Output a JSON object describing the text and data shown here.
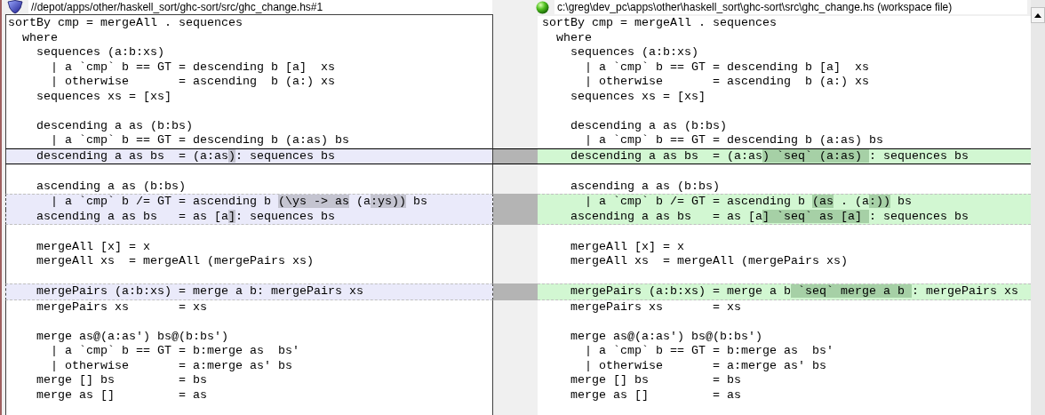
{
  "left_file": {
    "path": "//depot/apps/other/haskell_sort/ghc-sort/src/ghc_change.hs#1"
  },
  "right_file": {
    "path": "c:\\greg\\dev_pc\\apps\\other\\haskell_sort\\ghc-sort\\src\\ghc_change.hs (workspace file)"
  },
  "rows": [
    {
      "kind": "code",
      "left": "sortBy cmp = mergeAll . sequences",
      "right": "sortBy cmp = mergeAll . sequences"
    },
    {
      "kind": "code",
      "left": "  where",
      "right": "  where"
    },
    {
      "kind": "code",
      "left": "    sequences (a:b:xs)",
      "right": "    sequences (a:b:xs)"
    },
    {
      "kind": "code",
      "left": "      | a `cmp` b == GT = descending b [a]  xs",
      "right": "      | a `cmp` b == GT = descending b [a]  xs"
    },
    {
      "kind": "code",
      "left": "      | otherwise       = ascending  b (a:) xs",
      "right": "      | otherwise       = ascending  b (a:) xs"
    },
    {
      "kind": "code",
      "left": "    sequences xs = [xs]",
      "right": "    sequences xs = [xs]"
    },
    {
      "kind": "blank"
    },
    {
      "kind": "code",
      "left": "    descending a as (b:bs)",
      "right": "    descending a as (b:bs)"
    },
    {
      "kind": "code",
      "left": "      | a `cmp` b == GT = descending b (a:as) bs",
      "right": "      | a `cmp` b == GT = descending b (a:as) bs"
    },
    {
      "kind": "change",
      "current": true,
      "left": [
        {
          "text": "    descending a as bs  = (a:as",
          "changed": false
        },
        {
          "text": ")",
          "changed": true
        },
        {
          "text": ": sequences bs",
          "changed": false
        }
      ],
      "right": [
        {
          "text": "    descending a as bs  = (a:as",
          "changed": false
        },
        {
          "text": ") `seq` (a:as) ",
          "changed": true
        },
        {
          "text": ": sequences bs",
          "changed": false
        }
      ]
    },
    {
      "kind": "blank"
    },
    {
      "kind": "code",
      "left": "    ascending a as (b:bs)",
      "right": "    ascending a as (b:bs)"
    },
    {
      "kind": "change",
      "current": false,
      "left": [
        {
          "text": "      | a `cmp` b /= GT = ascending b ",
          "changed": false
        },
        {
          "text": "(\\ys -> as",
          "changed": true
        },
        {
          "text": " (a",
          "changed": false
        },
        {
          "text": ":ys))",
          "changed": true
        },
        {
          "text": " bs",
          "changed": false
        }
      ],
      "right": [
        {
          "text": "      | a `cmp` b /= GT = ascending b ",
          "changed": false
        },
        {
          "text": "(as",
          "changed": true
        },
        {
          "text": " . (a",
          "changed": false
        },
        {
          "text": ":))",
          "changed": true
        },
        {
          "text": " bs",
          "changed": false
        }
      ]
    },
    {
      "kind": "change",
      "current": false,
      "left": [
        {
          "text": "    ascending a as bs   = as [a",
          "changed": false
        },
        {
          "text": "]",
          "changed": true
        },
        {
          "text": ": sequences bs",
          "changed": false
        }
      ],
      "right": [
        {
          "text": "    ascending a as bs   = as [a",
          "changed": false
        },
        {
          "text": "] `seq` as [a] ",
          "changed": true
        },
        {
          "text": ": sequences bs",
          "changed": false
        }
      ]
    },
    {
      "kind": "blank"
    },
    {
      "kind": "code",
      "left": "    mergeAll [x] = x",
      "right": "    mergeAll [x] = x"
    },
    {
      "kind": "code",
      "left": "    mergeAll xs  = mergeAll (mergePairs xs)",
      "right": "    mergeAll xs  = mergeAll (mergePairs xs)"
    },
    {
      "kind": "blank"
    },
    {
      "kind": "change",
      "current": false,
      "left": [
        {
          "text": "    mergePairs (a:b:xs) = merge a b: mergePairs xs",
          "changed": false
        }
      ],
      "right": [
        {
          "text": "    mergePairs (a:b:xs) = merge a b",
          "changed": false
        },
        {
          "text": " `seq` merge a b ",
          "changed": true
        },
        {
          "text": ": mergePairs xs",
          "changed": false
        }
      ]
    },
    {
      "kind": "code",
      "left": "    mergePairs xs       = xs",
      "right": "    mergePairs xs       = xs"
    },
    {
      "kind": "blank"
    },
    {
      "kind": "code",
      "left": "    merge as@(a:as') bs@(b:bs')",
      "right": "    merge as@(a:as') bs@(b:bs')"
    },
    {
      "kind": "code",
      "left": "      | a `cmp` b == GT = b:merge as  bs'",
      "right": "      | a `cmp` b == GT = b:merge as  bs'"
    },
    {
      "kind": "code",
      "left": "      | otherwise       = a:merge as' bs",
      "right": "      | otherwise       = a:merge as' bs"
    },
    {
      "kind": "code",
      "left": "    merge [] bs         = bs",
      "right": "    merge [] bs         = bs"
    },
    {
      "kind": "code",
      "left": "    merge as []         = as",
      "right": "    merge as []         = as"
    },
    {
      "kind": "blank"
    }
  ]
}
